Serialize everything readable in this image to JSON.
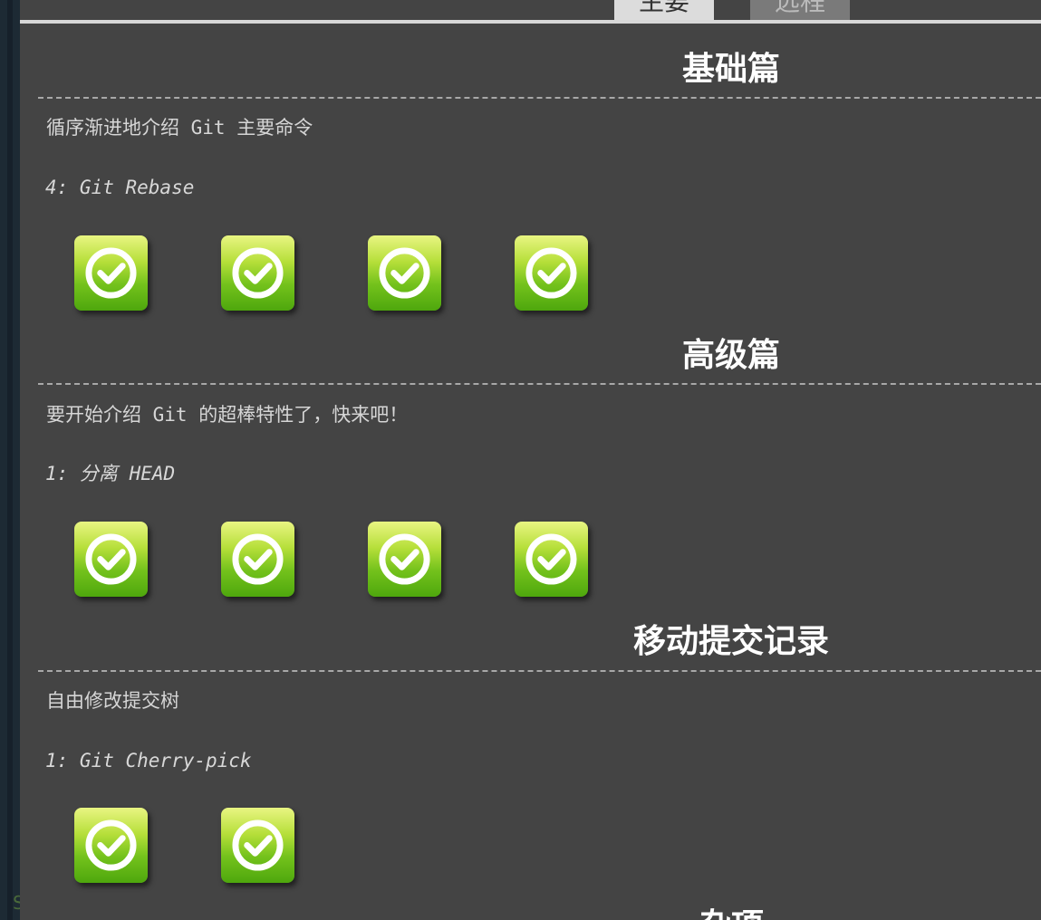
{
  "tabs": [
    {
      "label": "主要",
      "selected": true
    },
    {
      "label": "远程",
      "selected": false
    }
  ],
  "sections": [
    {
      "title": "基础篇",
      "description": "循序渐进地介绍 Git 主要命令",
      "current_level": "4: Git Rebase",
      "levels_completed": 4
    },
    {
      "title": "高级篇",
      "description": "要开始介绍 Git 的超棒特性了，快来吧！",
      "current_level": "1: 分离 HEAD",
      "levels_completed": 4
    },
    {
      "title": "移动提交记录",
      "description": "自由修改提交树",
      "current_level": "1: Git Cherry-pick",
      "levels_completed": 2
    },
    {
      "title": "杂项"
    }
  ],
  "icons": {
    "level_complete": "check-circle-icon"
  },
  "colors": {
    "panel_bg": "#444444",
    "level_green_top": "#e9f582",
    "level_green_bottom": "#4ea70d"
  }
}
